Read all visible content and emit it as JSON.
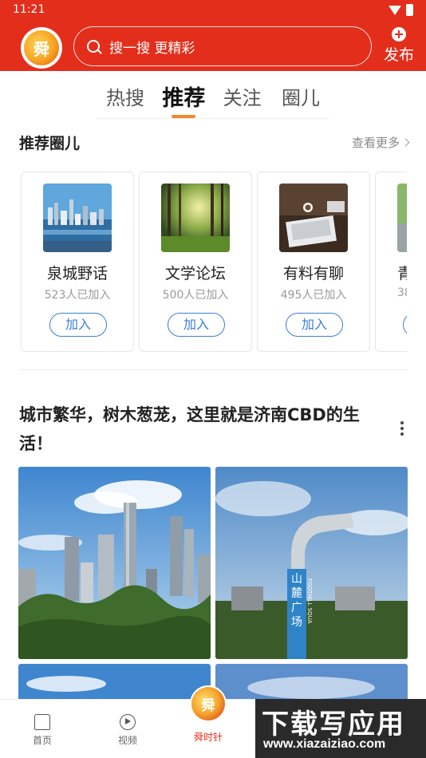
{
  "status_bar": {
    "time": "11:21"
  },
  "header": {
    "logo_text": "舜",
    "search_placeholder": "搜一搜 更精彩",
    "publish_label": "发布"
  },
  "tabs": [
    {
      "label": "热搜",
      "active": false
    },
    {
      "label": "推荐",
      "active": true
    },
    {
      "label": "关注",
      "active": false
    },
    {
      "label": "圈儿",
      "active": false
    }
  ],
  "recommended": {
    "title": "推荐圈儿",
    "more_label": "查看更多",
    "circles": [
      {
        "name": "泉城野话",
        "members": "523人已加入",
        "join_label": "加入"
      },
      {
        "name": "文学论坛",
        "members": "500人已加入",
        "join_label": "加入"
      },
      {
        "name": "有料有聊",
        "members": "495人已加入",
        "join_label": "加入"
      },
      {
        "name": "青",
        "members": "38",
        "join_label": ""
      }
    ]
  },
  "post": {
    "title": "城市繁华，树木葱茏，这里就是济南CBD的生活！",
    "sign_text": "山麓广场",
    "sign_sub": "FOOTHILL SQUA"
  },
  "bottom_nav": {
    "home_label": "首页",
    "video_label": "视频",
    "center_label": "舜时针",
    "center_logo_text": "舜"
  },
  "watermark": {
    "big": "下载写应用",
    "small": "www.xiazaiziao.com"
  },
  "colors": {
    "brand_red": "#e32e1c",
    "accent_orange": "#f08a2c",
    "join_blue": "#3b7fd8"
  }
}
